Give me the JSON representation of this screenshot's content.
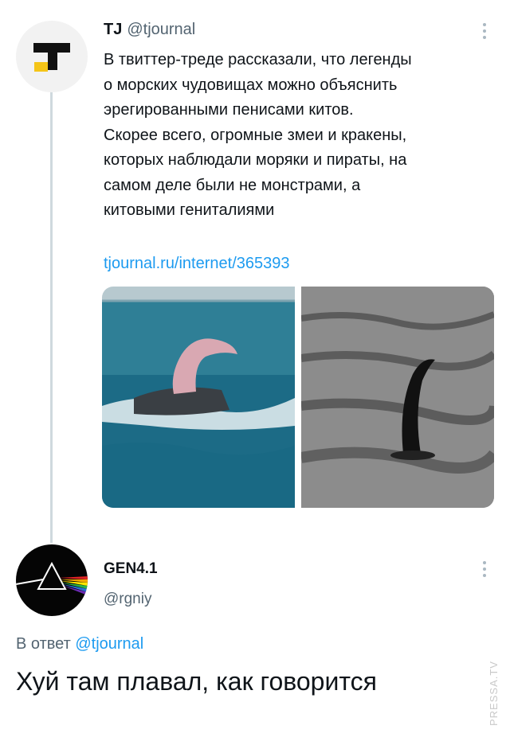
{
  "tweet": {
    "author_name": "TJ",
    "author_handle": "@tjournal",
    "text_lines": [
      "В твиттер-треде рассказали, что легенды",
      "о морских чудовищах можно объяснить",
      "эрегированными пенисами китов.",
      "Скорее всего, огромные змеи и кракены,",
      "которых наблюдали моряки и пираты, на",
      "самом деле были не монстрами, а",
      "китовыми гениталиями"
    ],
    "link": "tjournal.ru/internet/365393",
    "images": [
      "photo-whale-in-sea",
      "photo-lake-monster"
    ]
  },
  "reply": {
    "author_name": "GEN4.1",
    "author_handle": "@rgniy",
    "reply_prefix": "В ответ",
    "reply_mention": "@tjournal",
    "text": "Хуй там плавал, как говорится"
  },
  "watermark": "PRESSA.TV",
  "colors": {
    "link": "#1d9bf0",
    "secondary_text": "#536471",
    "thread_line": "#cfd9de",
    "tj_logo_yellow": "#f5c518"
  },
  "icons": [
    "more-vertical-icon",
    "tj-logo-avatar",
    "prism-avatar"
  ]
}
